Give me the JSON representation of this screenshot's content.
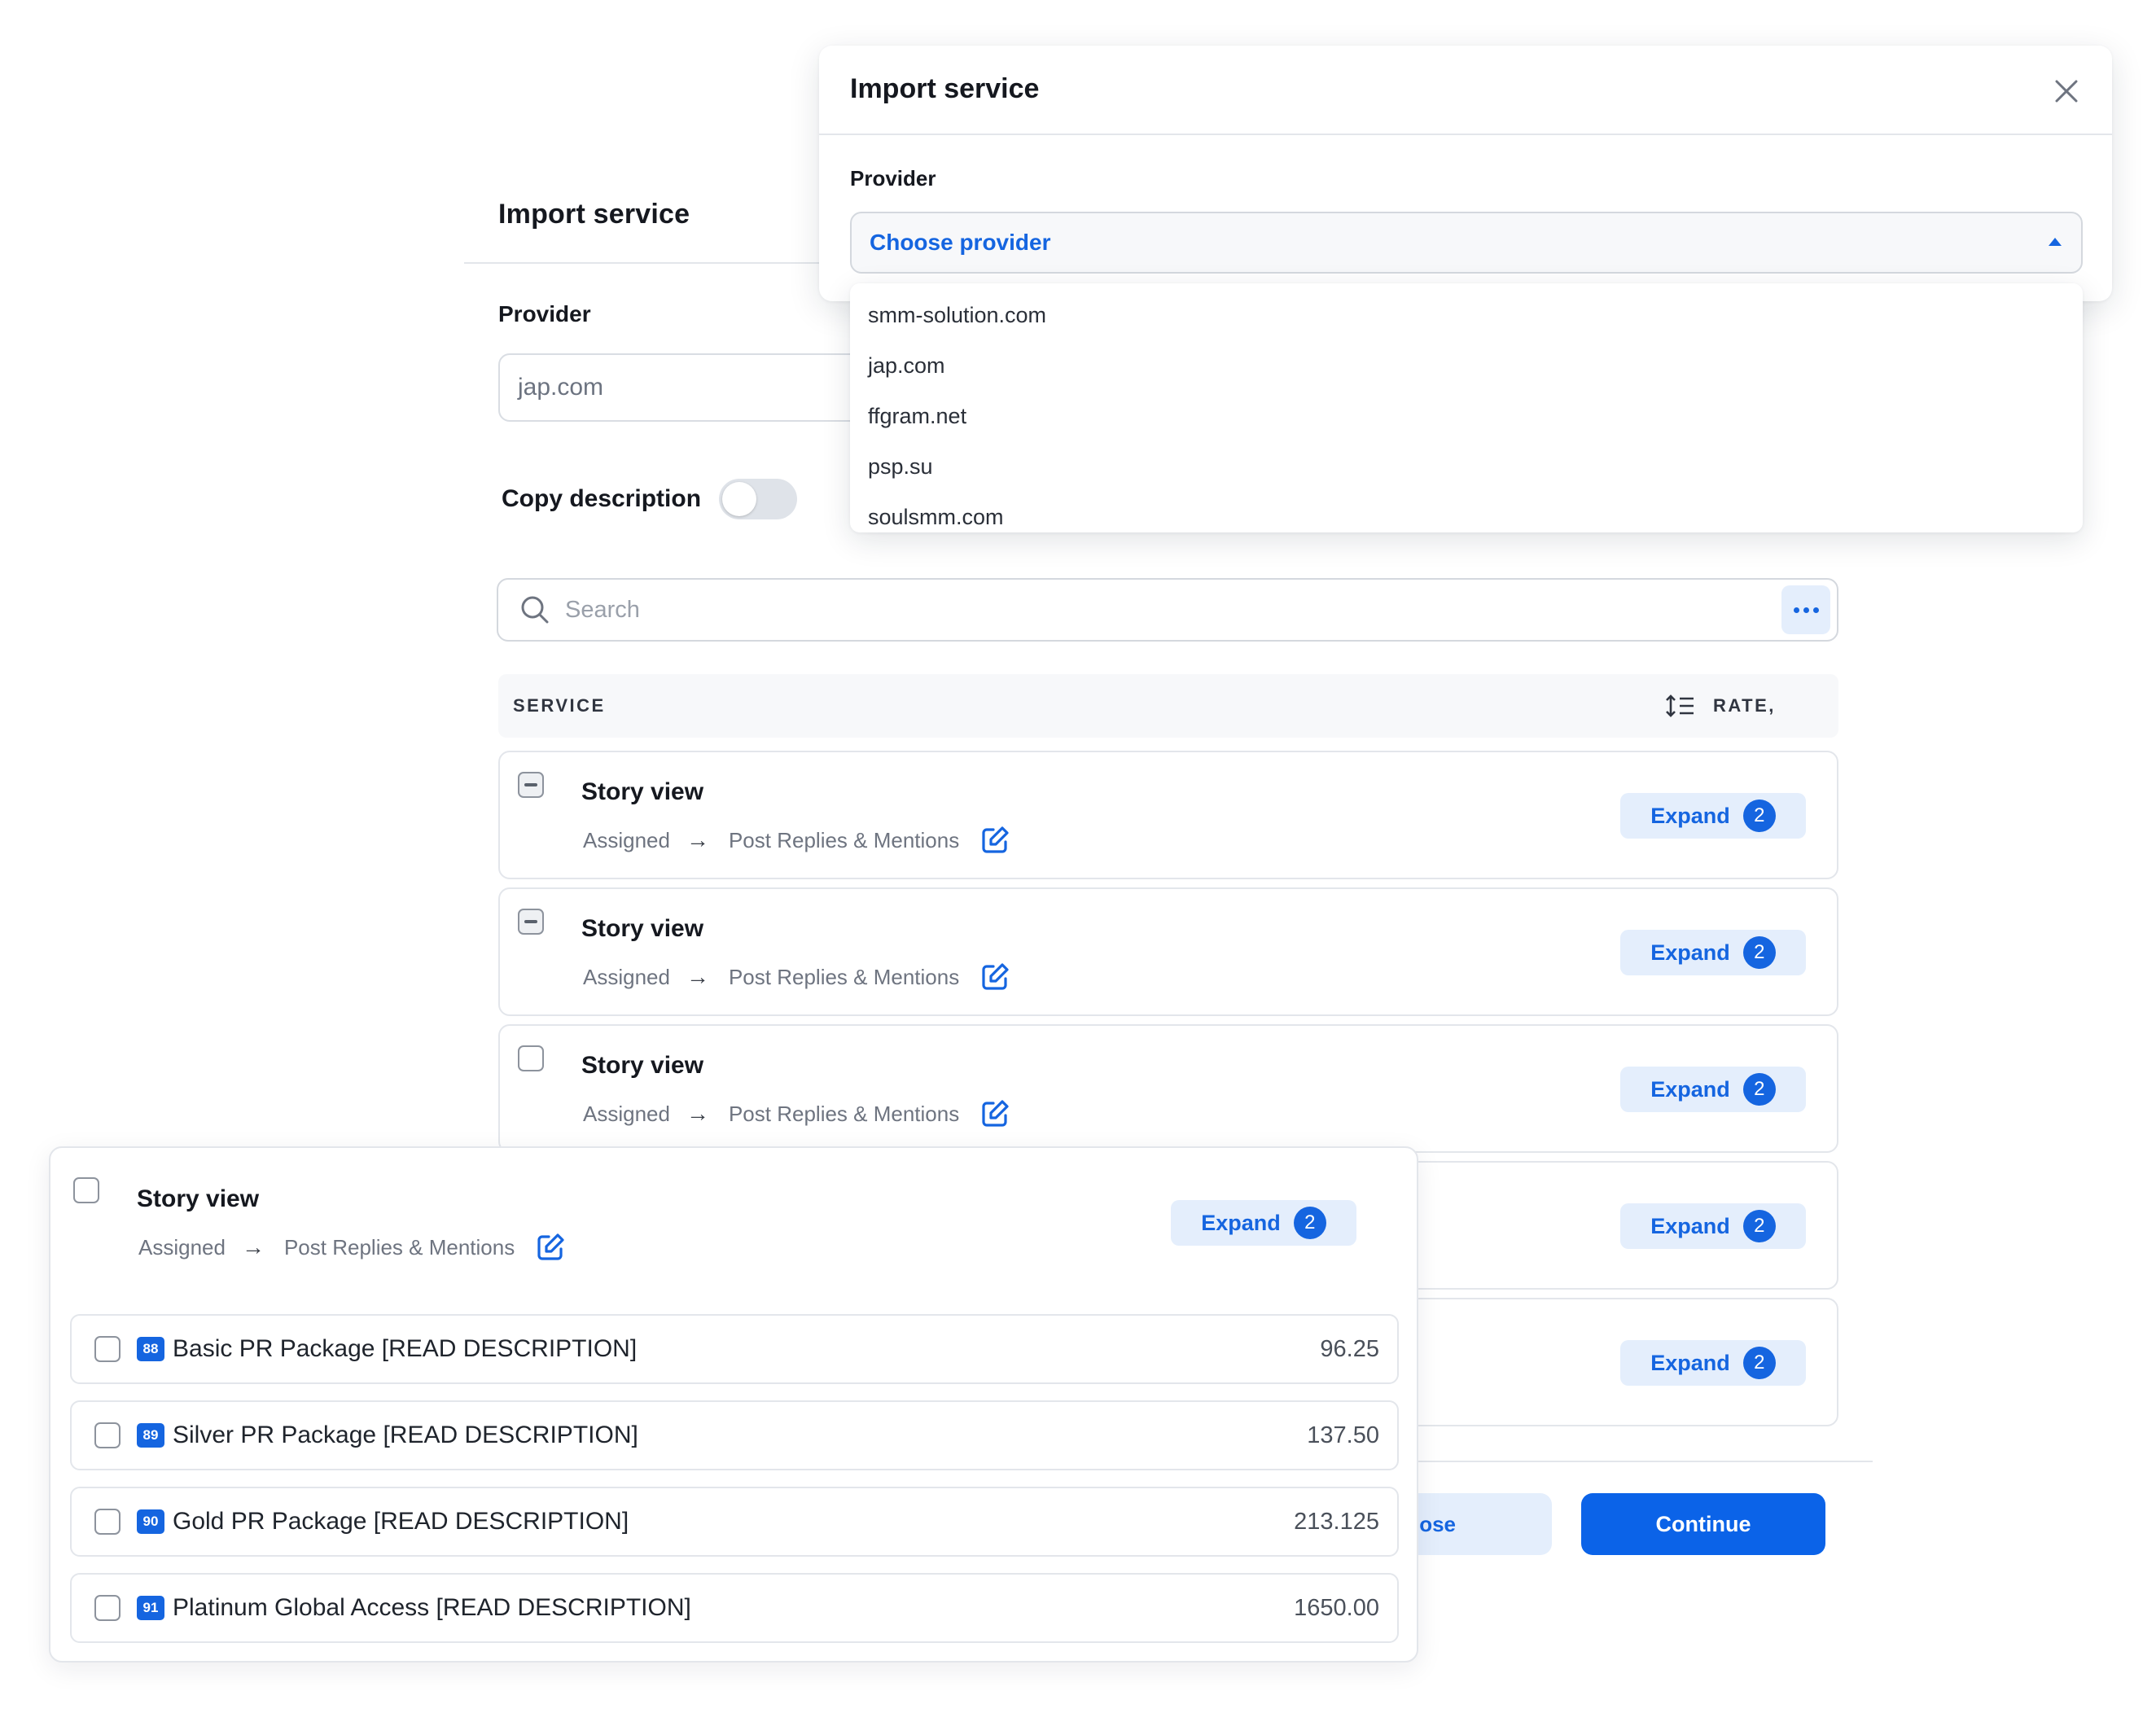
{
  "main": {
    "title": "Import service",
    "provider_label": "Provider",
    "provider_value": "jap.com",
    "copy_description_label": "Copy description",
    "search_placeholder": "Search",
    "table": {
      "col_service": "SERVICE",
      "col_rate": "RATE,"
    },
    "rows": [
      {
        "title": "Story view",
        "status": "Assigned",
        "category": "Post Replies & Mentions",
        "expand_label": "Expand",
        "count": "2",
        "checkbox": "indeterminate"
      },
      {
        "title": "Story view",
        "status": "Assigned",
        "category": "Post Replies & Mentions",
        "expand_label": "Expand",
        "count": "2",
        "checkbox": "indeterminate"
      },
      {
        "title": "Story view",
        "status": "Assigned",
        "category": "Post Replies & Mentions",
        "expand_label": "Expand",
        "count": "2",
        "checkbox": "unchecked"
      },
      {
        "expand_label": "Expand",
        "count": "2"
      },
      {
        "expand_label": "Expand",
        "count": "2"
      }
    ],
    "close_label": "ose",
    "continue_label": "Continue"
  },
  "modal": {
    "title": "Import service",
    "provider_label": "Provider",
    "select_placeholder": "Choose provider",
    "options": [
      "smm-solution.com",
      "jap.com",
      "ffgram.net",
      "psp.su",
      "soulsmm.com"
    ]
  },
  "expanded": {
    "title": "Story view",
    "status": "Assigned",
    "category": "Post Replies & Mentions",
    "expand_label": "Expand",
    "count": "2",
    "packages": [
      {
        "id": "88",
        "name": "Basic PR Package [READ DESCRIPTION]",
        "rate": "96.25"
      },
      {
        "id": "89",
        "name": "Silver PR Package [READ DESCRIPTION]",
        "rate": "137.50"
      },
      {
        "id": "90",
        "name": "Gold PR Package [READ DESCRIPTION]",
        "rate": "213.125"
      },
      {
        "id": "91",
        "name": "Platinum Global Access [READ DESCRIPTION]",
        "rate": "1650.00"
      }
    ]
  },
  "colors": {
    "accent": "#1565e0",
    "accent_light": "#e4eefc",
    "border": "#e3e6eb",
    "text": "#15181f",
    "muted": "#6e7480"
  },
  "icons": {
    "search": "search-icon",
    "more": "more-horizontal-icon",
    "sort": "sort-icon",
    "arrow": "arrow-right-icon",
    "edit": "edit-icon",
    "close": "close-icon",
    "caret": "caret-up-icon"
  }
}
